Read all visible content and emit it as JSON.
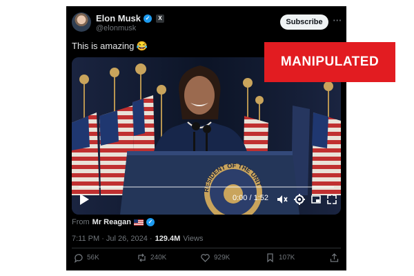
{
  "post": {
    "author_name": "Elon Musk",
    "author_handle": "@elonmusk",
    "subscribe_label": "Subscribe",
    "more_label": "···",
    "text": "This is amazing 😂",
    "video": {
      "time": "0:00 / 1:52",
      "progress": 0,
      "seal_text": "RESIDENT OF THE UNIT"
    },
    "from_label": "From",
    "from_name": "Mr Reagan",
    "timestamp": "7:11 PM · Jul 26, 2024 ·",
    "views_count": "129.4M",
    "views_label": "Views",
    "actions": {
      "replies": "56K",
      "reposts": "240K",
      "likes": "929K",
      "bookmarks": "107K"
    }
  },
  "overlay": {
    "label": "MANIPULATED",
    "color": "#e21c21"
  },
  "icons": [
    "verified-badge-icon",
    "x-affiliate-icon",
    "play-icon",
    "volume-mute-icon",
    "settings-icon",
    "pip-icon",
    "fullscreen-icon",
    "reply-icon",
    "repost-icon",
    "like-icon",
    "bookmark-icon",
    "share-icon",
    "us-flag-icon"
  ],
  "colors": {
    "background": "#000000",
    "accent": "#1d9bf0",
    "muted": "#71767b"
  }
}
